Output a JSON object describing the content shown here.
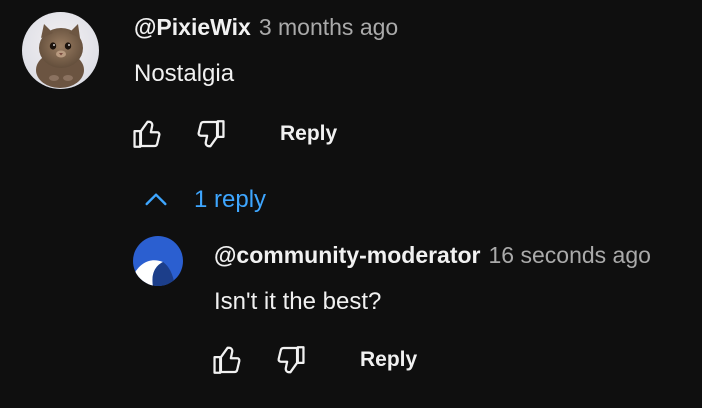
{
  "colors": {
    "background": "#0f0f0f",
    "text": "#f1f1f1",
    "secondary_text": "#aaaaaa",
    "link_blue": "#3ea6ff"
  },
  "comment": {
    "author": "@PixieWix",
    "time": "3 months ago",
    "text": "Nostalgia",
    "avatar_icon": "kitten-avatar",
    "like_icon": "thumbs-up-icon",
    "dislike_icon": "thumbs-down-icon",
    "reply_label": "Reply"
  },
  "replies_toggle": {
    "icon": "chevron-up-icon",
    "label": "1 reply"
  },
  "reply": {
    "author": "@community-moderator",
    "time": "16 seconds ago",
    "text": "Isn't it the best?",
    "avatar_icon": "moderator-avatar",
    "like_icon": "thumbs-up-icon",
    "dislike_icon": "thumbs-down-icon",
    "reply_label": "Reply"
  }
}
